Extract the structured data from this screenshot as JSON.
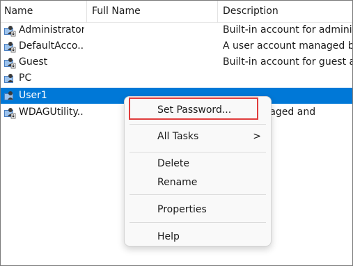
{
  "columns": {
    "name": "Name",
    "full_name": "Full Name",
    "description": "Description"
  },
  "rows": [
    {
      "name": "Administrator",
      "full_name": "",
      "description": "Built-in account for administ"
    },
    {
      "name": "DefaultAcco...",
      "full_name": "",
      "description": "A user account managed by t"
    },
    {
      "name": "Guest",
      "full_name": "",
      "description": "Built-in account for guest acc"
    },
    {
      "name": "PC",
      "full_name": "",
      "description": ""
    },
    {
      "name": "User1",
      "full_name": "",
      "description": ""
    },
    {
      "name": "WDAGUtility...",
      "full_name": "",
      "description": "ount managed and"
    }
  ],
  "selected_row": "User1",
  "context_menu": {
    "items": [
      {
        "label": "Set Password..."
      },
      {
        "label": "All Tasks",
        "submenu_arrow": ">"
      },
      {
        "label": "Delete"
      },
      {
        "label": "Rename"
      },
      {
        "label": "Properties"
      },
      {
        "label": "Help"
      }
    ]
  },
  "icons": {
    "user": "user-account-icon"
  },
  "colors": {
    "selection": "#0078d7",
    "highlight_border": "#e03c3c"
  }
}
